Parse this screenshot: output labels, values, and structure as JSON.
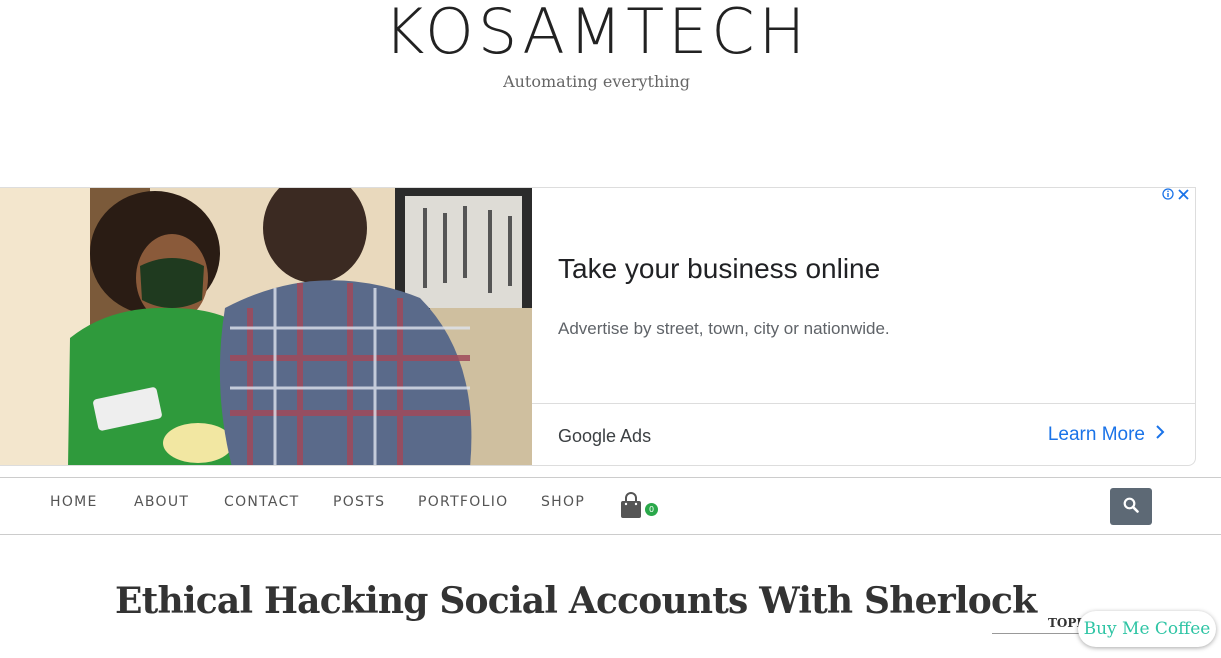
{
  "header": {
    "site_title": "KOSAMTECH",
    "tagline": "Automating everything"
  },
  "ad": {
    "headline": "Take your business online",
    "body": "Advertise by street, town, city or nationwide.",
    "advertiser": "Google Ads",
    "cta_label": "Learn More",
    "info_icon": "info-icon",
    "close_icon": "close-icon"
  },
  "nav": {
    "items": [
      {
        "label": "HOME"
      },
      {
        "label": "ABOUT"
      },
      {
        "label": "CONTACT"
      },
      {
        "label": "POSTS"
      },
      {
        "label": "PORTFOLIO"
      },
      {
        "label": "SHOP"
      }
    ],
    "cart_icon": "shopping-bag-icon",
    "cart_count": "0",
    "search_icon": "search-icon"
  },
  "post": {
    "title": "Ethical Hacking Social Accounts With Sherlock"
  },
  "sidebar": {
    "topics_heading": "TOPICS"
  },
  "coffee_button": {
    "label": "Buy Me Coffee"
  },
  "colors": {
    "accent_blue": "#1a73e8",
    "search_button_bg": "#5d6975",
    "cart_badge": "#2aa84a",
    "coffee_text": "#2ec4a4"
  }
}
